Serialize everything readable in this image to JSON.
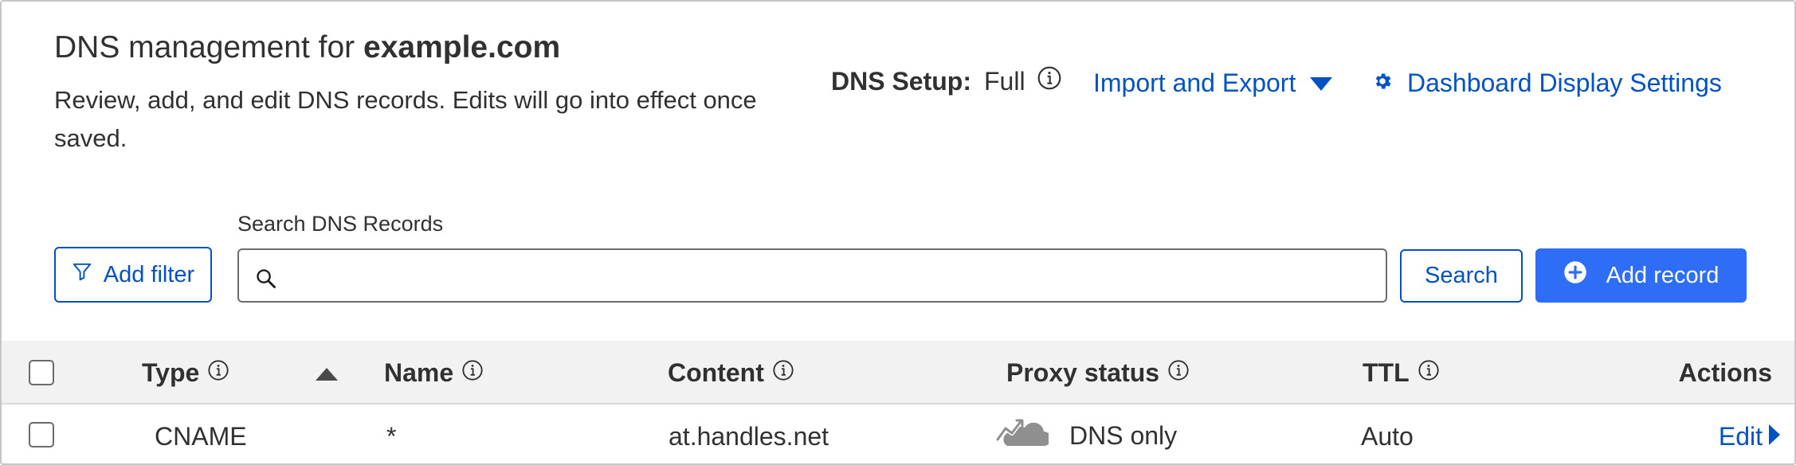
{
  "header": {
    "title_prefix": "DNS management for ",
    "domain": "example.com",
    "description": "Review, add, and edit DNS records. Edits will go into effect once saved.",
    "dns_setup_label": "DNS Setup:",
    "dns_setup_value": "Full",
    "import_export_label": "Import and Export",
    "display_settings_label": "Dashboard Display Settings"
  },
  "toolbar": {
    "add_filter_label": "Add filter",
    "search_label": "Search DNS Records",
    "search_value": "",
    "search_button_label": "Search",
    "add_record_label": "Add record"
  },
  "table": {
    "columns": {
      "type": "Type",
      "name": "Name",
      "content": "Content",
      "proxy_status": "Proxy status",
      "ttl": "TTL",
      "actions": "Actions"
    },
    "rows": [
      {
        "type": "CNAME",
        "name": "*",
        "content": "at.handles.net",
        "proxy_status": "DNS only",
        "ttl": "Auto",
        "action": "Edit"
      }
    ]
  },
  "colors": {
    "link": "#0051c3",
    "primary_button": "#2e6df6",
    "header_bg": "#f2f2f2",
    "cloud_gray": "#8f8f8f"
  },
  "icons": {
    "info": "info-circle-icon",
    "caret": "caret-down-icon",
    "settings": "gear-icon",
    "filter": "filter-icon",
    "search": "search-icon",
    "add": "plus-circle-icon",
    "sort": "sort-ascending-icon",
    "proxy": "dns-only-cloud-icon",
    "edit_arrow": "caret-right-icon"
  }
}
